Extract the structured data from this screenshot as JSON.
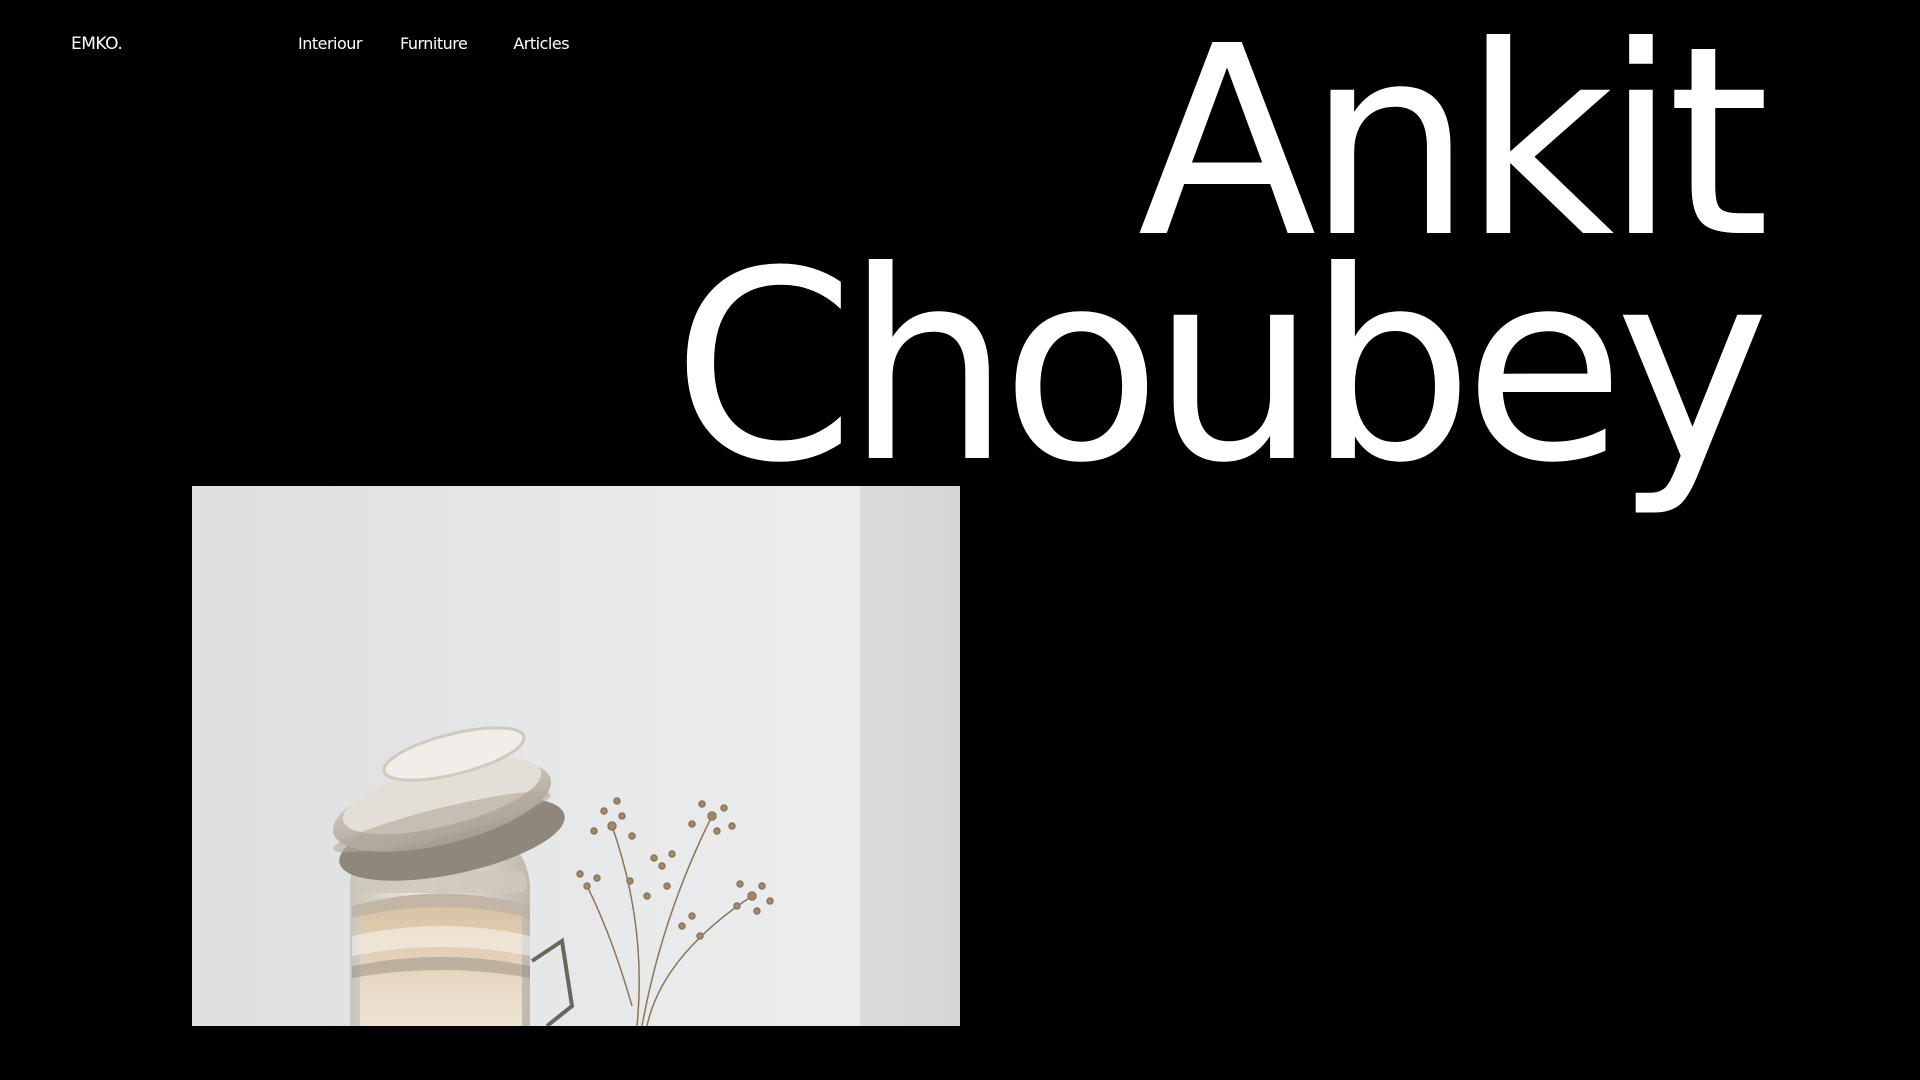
{
  "header": {
    "logo": "EMKO.",
    "nav": [
      {
        "label": "Interiour"
      },
      {
        "label": "Furniture"
      },
      {
        "label": "Articles"
      }
    ]
  },
  "hero": {
    "line1": "Ankit",
    "line2": "Choubey"
  },
  "colors": {
    "background": "#000000",
    "text": "#ffffff",
    "photo_backdrop": "#e6e7e8"
  }
}
